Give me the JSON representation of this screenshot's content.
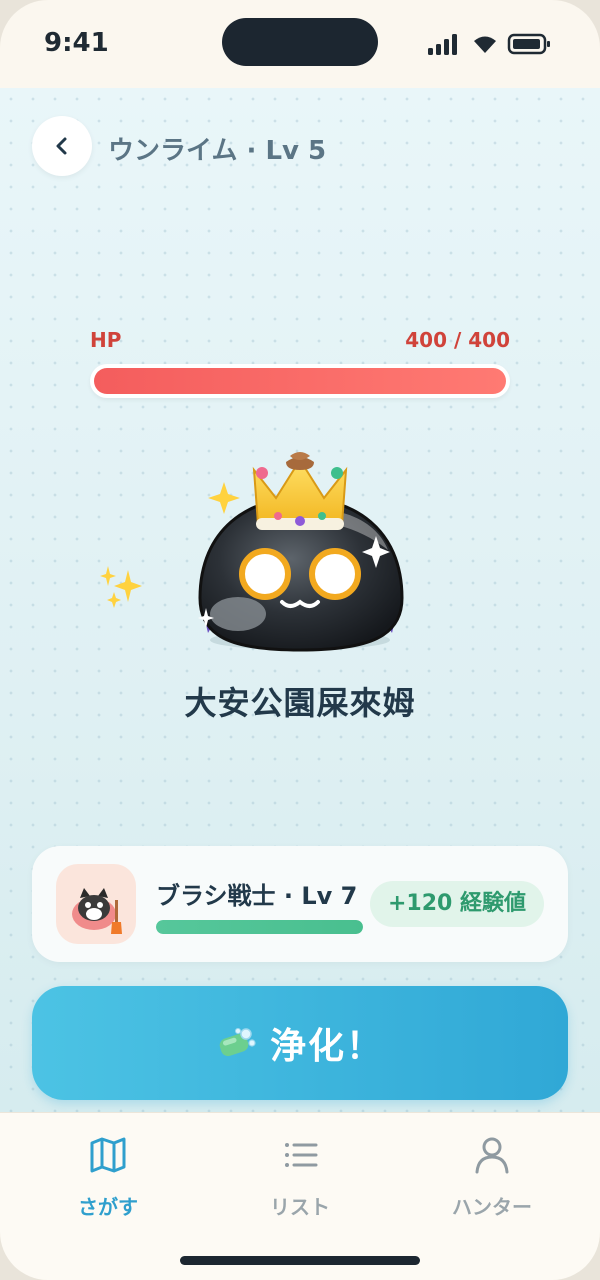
{
  "status_bar": {
    "time": "9:41"
  },
  "header": {
    "title": "ウンライム · Lv 5"
  },
  "hp": {
    "label": "HP",
    "value_text": "400 / 400",
    "current": 400,
    "max": 400
  },
  "monster": {
    "name": "大安公園屎來姆"
  },
  "hunter": {
    "name": "ブラシ戦士 · Lv 7",
    "exp_badge": "+120 経験値",
    "progress": 1.0
  },
  "action": {
    "label": "浄化！",
    "icon": "soap-icon"
  },
  "tabs": [
    {
      "label": "さがす",
      "icon": "map-icon",
      "active": true
    },
    {
      "label": "リスト",
      "icon": "list-icon",
      "active": false
    },
    {
      "label": "ハンター",
      "icon": "person-icon",
      "active": false
    }
  ],
  "colors": {
    "accent": "#2f9fcd",
    "hp_fill": "#f45d5d",
    "exp_green": "#2e9a6e",
    "button": "#30a8d6"
  }
}
